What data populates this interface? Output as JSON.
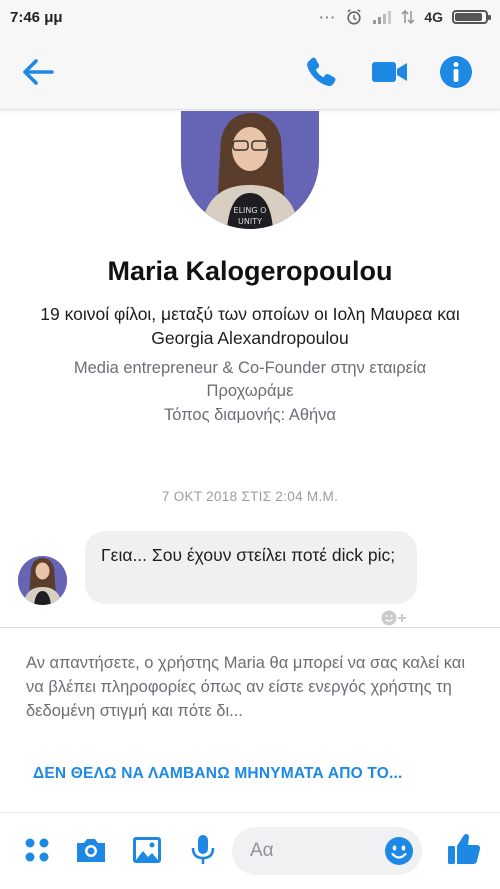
{
  "status_bar": {
    "time": "7:46 μμ",
    "network": "4G",
    "battery_level": 0.92
  },
  "header": {
    "back_icon": "arrow-left-icon",
    "call_icon": "phone-icon",
    "video_icon": "video-camera-icon",
    "info_icon": "info-icon"
  },
  "profile": {
    "name": "Maria Kalogeropoulou",
    "mutual_friends": "19 κοινοί φίλοι, μεταξύ των οποίων οι Ιολη Μαυρεα και Georgia Alexandropoulou",
    "work": "Media entrepreneur & Co-Founder στην εταιρεία Προχωράμε",
    "home": "Τόπος διαμονής: Αθήνα"
  },
  "conversation": {
    "timestamp": "7 ΟΚΤ 2018 ΣΤΙΣ 2:04 Μ.Μ.",
    "messages": [
      {
        "text": "Γεια... Σου έχουν στείλει ποτέ dick pic;",
        "from": "Maria Kalogeropoulou"
      }
    ]
  },
  "notice": {
    "text": "Αν απαντήσετε, ο χρήστης Maria θα μπορεί να σας καλεί και να βλέπει πληροφορίες όπως αν είστε ενεργός χρήστης τη δεδομένη στιγμή και πότε δι...",
    "block_link": "ΔΕΝ ΘΕΛΩ ΝΑ ΛΑΜΒΑΝΩ ΜΗΝΥΜΑΤΑ ΑΠΟ ΤΟ..."
  },
  "composer": {
    "placeholder": "Αα",
    "icons": [
      "grid-menu-icon",
      "camera-icon",
      "gallery-icon",
      "microphone-icon",
      "emoji-icon",
      "thumbs-up-icon"
    ]
  },
  "colors": {
    "accent": "#1e88e5",
    "bubble": "#f1f0f0",
    "muted_text": "#6b6f75"
  }
}
